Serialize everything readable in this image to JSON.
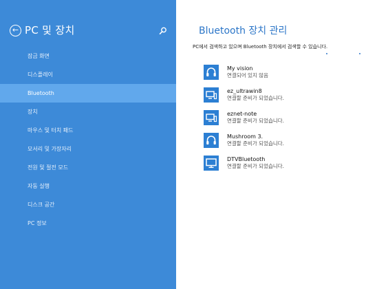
{
  "sidebar": {
    "back_glyph": "←",
    "title": "PC 및 장치",
    "search_icon": "search-icon",
    "items": [
      {
        "label": "잠금 화면",
        "selected": false
      },
      {
        "label": "디스플레이",
        "selected": false
      },
      {
        "label": "Bluetooth",
        "selected": true
      },
      {
        "label": "장치",
        "selected": false
      },
      {
        "label": "마우스 및 터치 패드",
        "selected": false
      },
      {
        "label": "모서리 및 가장자리",
        "selected": false
      },
      {
        "label": "전원 및 절전 모드",
        "selected": false
      },
      {
        "label": "자동 실행",
        "selected": false
      },
      {
        "label": "디스크 공간",
        "selected": false
      },
      {
        "label": "PC 정보",
        "selected": false
      }
    ]
  },
  "main": {
    "title": "Bluetooth 장치 관리",
    "description": "PC에서 검색하고 있으며 Bluetooth 장치에서 검색할 수 있습니다.",
    "devices": [
      {
        "name": "My vision",
        "status": "연결되어 있지 않음",
        "icon": "headset-icon"
      },
      {
        "name": "ez_ultrawin8",
        "status": "연결할 준비가 되었습니다.",
        "icon": "computer-icon"
      },
      {
        "name": "eznet-note",
        "status": "연결할 준비가 되었습니다.",
        "icon": "computer-icon"
      },
      {
        "name": "Mushroom 3.",
        "status": "연결할 준비가 되었습니다.",
        "icon": "headset-icon"
      },
      {
        "name": "DTVBluetooth",
        "status": "연결할 준비가 되었습니다.",
        "icon": "monitor-icon"
      }
    ]
  },
  "colors": {
    "sidebar_bg": "#3d8ad8",
    "selected_bg": "#61a8ec",
    "accent": "#2c76c8",
    "icon_bg": "#2c7fd3"
  }
}
